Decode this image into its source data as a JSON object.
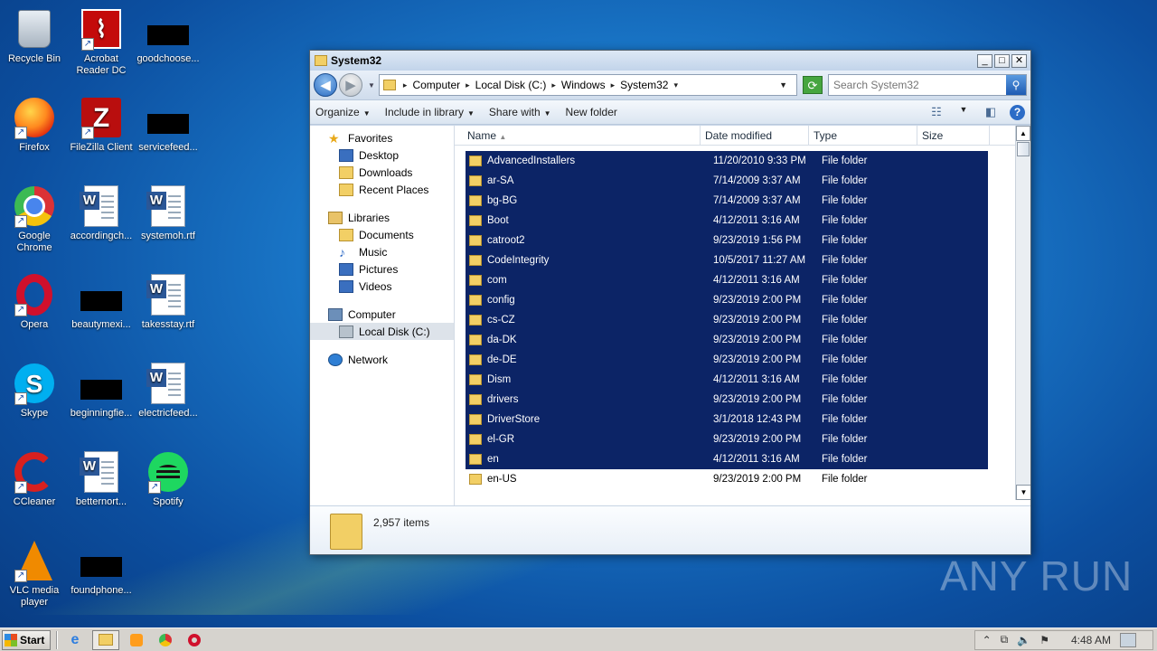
{
  "desktop": {
    "icons": [
      {
        "label": "Recycle Bin"
      },
      {
        "label": "Acrobat Reader DC"
      },
      {
        "label": "goodchoose..."
      },
      {
        "label": "Firefox"
      },
      {
        "label": "FileZilla Client"
      },
      {
        "label": "servicefeed..."
      },
      {
        "label": "Google Chrome"
      },
      {
        "label": "accordingch..."
      },
      {
        "label": "systemoh.rtf"
      },
      {
        "label": "Opera"
      },
      {
        "label": "beautymexi..."
      },
      {
        "label": "takesstay.rtf"
      },
      {
        "label": "Skype"
      },
      {
        "label": "beginningfie..."
      },
      {
        "label": "electricfeed..."
      },
      {
        "label": "CCleaner"
      },
      {
        "label": "betternort..."
      },
      {
        "label": "Spotify"
      },
      {
        "label": "VLC media player"
      },
      {
        "label": "foundphone..."
      }
    ],
    "watermark": "ANY RUN"
  },
  "window": {
    "title": "System32",
    "controls": {
      "minimize": "_",
      "maximize": "□",
      "close": "✕"
    },
    "address": {
      "crumbs": [
        "Computer",
        "Local Disk (C:)",
        "Windows",
        "System32"
      ]
    },
    "search": {
      "placeholder": "Search System32"
    },
    "toolbar": {
      "organize": "Organize",
      "include_in_library": "Include in library",
      "share_with": "Share with",
      "new_folder": "New folder"
    },
    "nav": {
      "favorites": "Favorites",
      "desktop": "Desktop",
      "downloads": "Downloads",
      "recent_places": "Recent Places",
      "libraries": "Libraries",
      "documents": "Documents",
      "music": "Music",
      "pictures": "Pictures",
      "videos": "Videos",
      "computer": "Computer",
      "local_disk": "Local Disk (C:)",
      "network": "Network"
    },
    "columns": {
      "name": "Name",
      "date_modified": "Date modified",
      "type": "Type",
      "size": "Size"
    },
    "files": [
      {
        "name": "AdvancedInstallers",
        "date": "11/20/2010 9:33 PM",
        "type": "File folder"
      },
      {
        "name": "ar-SA",
        "date": "7/14/2009 3:37 AM",
        "type": "File folder"
      },
      {
        "name": "bg-BG",
        "date": "7/14/2009 3:37 AM",
        "type": "File folder"
      },
      {
        "name": "Boot",
        "date": "4/12/2011 3:16 AM",
        "type": "File folder"
      },
      {
        "name": "catroot2",
        "date": "9/23/2019 1:56 PM",
        "type": "File folder"
      },
      {
        "name": "CodeIntegrity",
        "date": "10/5/2017 11:27 AM",
        "type": "File folder"
      },
      {
        "name": "com",
        "date": "4/12/2011 3:16 AM",
        "type": "File folder"
      },
      {
        "name": "config",
        "date": "9/23/2019 2:00 PM",
        "type": "File folder"
      },
      {
        "name": "cs-CZ",
        "date": "9/23/2019 2:00 PM",
        "type": "File folder"
      },
      {
        "name": "da-DK",
        "date": "9/23/2019 2:00 PM",
        "type": "File folder"
      },
      {
        "name": "de-DE",
        "date": "9/23/2019 2:00 PM",
        "type": "File folder"
      },
      {
        "name": "Dism",
        "date": "4/12/2011 3:16 AM",
        "type": "File folder"
      },
      {
        "name": "drivers",
        "date": "9/23/2019 2:00 PM",
        "type": "File folder"
      },
      {
        "name": "DriverStore",
        "date": "3/1/2018 12:43 PM",
        "type": "File folder"
      },
      {
        "name": "el-GR",
        "date": "9/23/2019 2:00 PM",
        "type": "File folder"
      },
      {
        "name": "en",
        "date": "4/12/2011 3:16 AM",
        "type": "File folder"
      },
      {
        "name": "en-US",
        "date": "9/23/2019 2:00 PM",
        "type": "File folder"
      }
    ],
    "status": {
      "item_count": "2,957 items"
    }
  },
  "taskbar": {
    "start": "Start",
    "clock": "4:48 AM"
  }
}
